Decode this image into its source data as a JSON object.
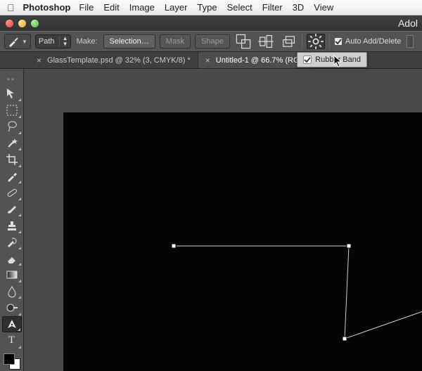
{
  "osx": {
    "app": "Photoshop",
    "menu": [
      "File",
      "Edit",
      "Image",
      "Layer",
      "Type",
      "Select",
      "Filter",
      "3D",
      "View"
    ]
  },
  "window": {
    "brand": "Adol"
  },
  "options": {
    "mode": "Path",
    "make_label": "Make:",
    "selection_btn": "Selection…",
    "mask_btn": "Mask",
    "shape_btn": "Shape",
    "auto_add_delete": "Auto Add/Delete",
    "rubber_band": "Rubber Band"
  },
  "tabs": {
    "0": {
      "label": "GlassTemplate.psd @ 32% (3, CMYK/8) *"
    },
    "1": {
      "label": "Untitled-1 @ 66.7% (RGB"
    }
  },
  "tool_names": [
    "move",
    "marquee",
    "lasso",
    "magic-wand",
    "crop",
    "eyedropper",
    "healing-brush",
    "brush",
    "clone-stamp",
    "history-brush",
    "eraser",
    "gradient",
    "blur",
    "dodge",
    "pen",
    "type"
  ]
}
